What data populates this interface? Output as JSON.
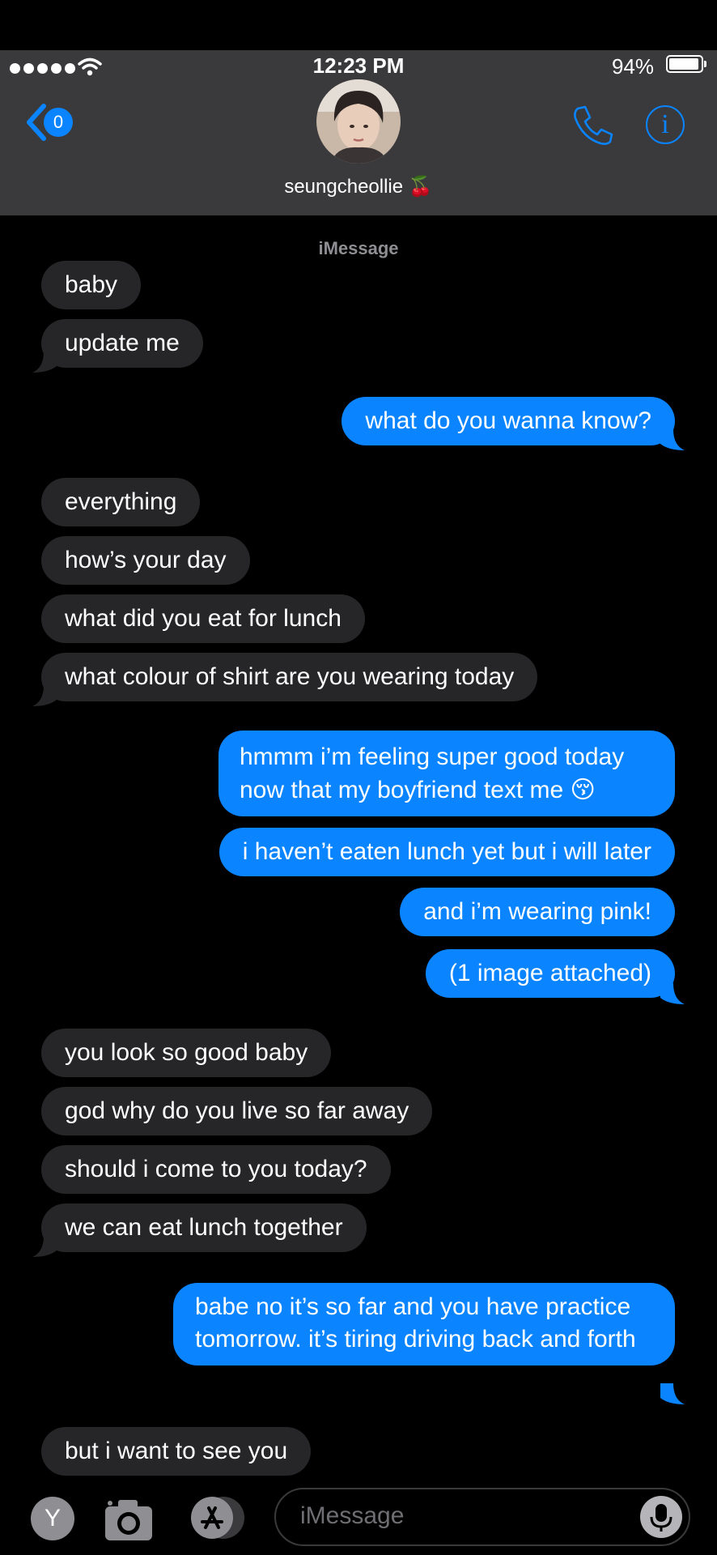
{
  "status_bar": {
    "time": "12:23 PM",
    "battery": "94%"
  },
  "header": {
    "back_badge": "0",
    "contact_name": "seungcheollie 🍒",
    "service_label": "iMessage"
  },
  "messages": [
    {
      "from": "them",
      "text": "baby"
    },
    {
      "from": "them",
      "text": "update me"
    },
    {
      "from": "me",
      "text": "what do you wanna know?"
    },
    {
      "from": "them",
      "text": "everything"
    },
    {
      "from": "them",
      "text": "how’s your day"
    },
    {
      "from": "them",
      "text": "what did you eat for lunch"
    },
    {
      "from": "them",
      "text": "what colour of shirt are you wearing today"
    },
    {
      "from": "me",
      "text": "hmmm i’m feeling super good today now that my boyfriend text me 😚"
    },
    {
      "from": "me",
      "text": "i haven’t eaten lunch yet but i will later"
    },
    {
      "from": "me",
      "text": "and i’m wearing pink!"
    },
    {
      "from": "me",
      "text": "(1 image attached)"
    },
    {
      "from": "them",
      "text": "you look so good baby"
    },
    {
      "from": "them",
      "text": "god why do you live so far away"
    },
    {
      "from": "them",
      "text": "should i come to you today?"
    },
    {
      "from": "them",
      "text": "we can eat lunch together"
    },
    {
      "from": "me",
      "text": "babe no it’s so far and you have practice tomorrow. it’s tiring driving back and forth"
    },
    {
      "from": "them",
      "text": "but i want to see you"
    }
  ],
  "toolbar": {
    "apps_letter": "Y",
    "input_placeholder": "iMessage"
  },
  "colors": {
    "accent": "#0a84ff",
    "incoming_bubble": "#262628",
    "header_bg": "#3a3a3c"
  }
}
